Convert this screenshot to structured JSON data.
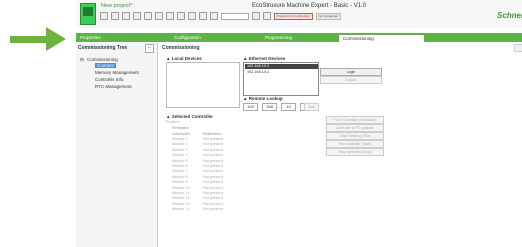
{
  "window": {
    "project_name": "New project*",
    "app_title": "EcoStruxure Machine Expert - Basic - V1.0",
    "brand": "Schnei",
    "brand_sub": "Electric"
  },
  "toolbar": {
    "status_error": "Program errors detected",
    "status_info": "Not connected"
  },
  "tabs": [
    {
      "label": "Properties"
    },
    {
      "label": "Configuration"
    },
    {
      "label": "Programming"
    },
    {
      "label": "Commissioning"
    }
  ],
  "left_panel": {
    "title": "Commissioning Tree",
    "collapse_label": "−",
    "items": [
      {
        "label": "Commissioning"
      },
      {
        "label": "Connect"
      },
      {
        "label": "Memory Management"
      },
      {
        "label": "Controller Info."
      },
      {
        "label": "RTC Management"
      }
    ]
  },
  "main": {
    "title": "Commissioning",
    "local_devices": "Local Devices",
    "ethernet_devices": "Ethernet Devices",
    "eth_list": [
      {
        "label": "192.168.10.2",
        "selected": true
      },
      {
        "label": "192.168.10.1",
        "selected": false
      }
    ],
    "login": "Login",
    "logout": "Logout",
    "remote_lookup": "Remote Lookup",
    "ip": [
      "192",
      "168",
      "10",
      "2"
    ],
    "add": "Add",
    "actions": [
      "PC to Controller (download)",
      "Controller to PC (upload)",
      "Start Flashing LEDs",
      "Run controller (Start)",
      "Stop controller (Stop)"
    ],
    "selected_controller": "Selected Controller",
    "product": "Product",
    "firmware": "Firmware",
    "controller_col": "Controller",
    "reference_col": "Reference",
    "modules": [
      {
        "name": "Module 1",
        "status": "Not present"
      },
      {
        "name": "Module 2",
        "status": "Not present"
      },
      {
        "name": "Module 3",
        "status": "Not present"
      },
      {
        "name": "Module 4",
        "status": "Not present"
      },
      {
        "name": "Module 5",
        "status": "Not present"
      },
      {
        "name": "Module 6",
        "status": "Not present"
      },
      {
        "name": "Module 7",
        "status": "Not present"
      },
      {
        "name": "Module 8",
        "status": "Not present"
      },
      {
        "name": "Module 9",
        "status": "Not present"
      },
      {
        "name": "Module 10",
        "status": "Not present"
      },
      {
        "name": "Module 11",
        "status": "Not present"
      },
      {
        "name": "Module 12",
        "status": "Not present"
      },
      {
        "name": "Module 13",
        "status": "Not present"
      },
      {
        "name": "Module 14",
        "status": "Not present"
      }
    ]
  },
  "colors": {
    "accent_green": "#5fb346",
    "arrow_green": "#6cb33f",
    "selection_blue": "#4d8fd6"
  }
}
